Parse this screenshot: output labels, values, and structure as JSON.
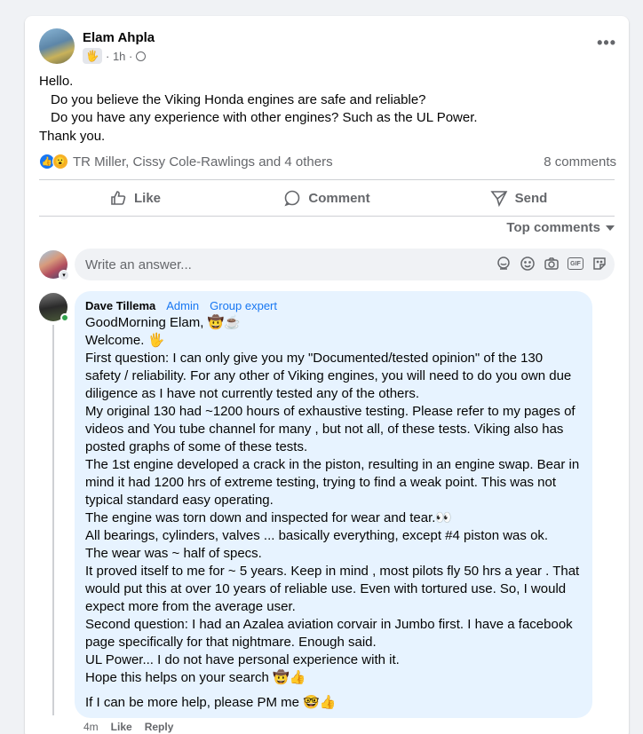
{
  "post": {
    "author": "Elam Ahpla",
    "badge_icon": "wave-hand-icon",
    "time": "· 1h ·",
    "privacy_icon": "globe-icon",
    "more_label": "•••",
    "lines": [
      "Hello.",
      "Do you believe the Viking Honda engines are safe and reliable?",
      "Do you have any experience with other engines? Such as the UL Power.",
      "Thank you."
    ],
    "reactions_text": "TR Miller, Cissy Cole-Rawlings and 4 others",
    "comments_count": "8 comments"
  },
  "actions": {
    "like": "Like",
    "comment": "Comment",
    "send": "Send"
  },
  "sort": {
    "label": "Top comments"
  },
  "composer": {
    "placeholder": "Write an answer..."
  },
  "comment": {
    "author": "Dave Tillema",
    "role1": "Admin",
    "role2": "Group expert",
    "lines": [
      "GoodMorning Elam, 🤠☕",
      "Welcome. 🖐",
      "First question: I can only give you my \"Documented/tested opinion\" of the 130",
      "safety / reliability. For any other of Viking engines, you will need to do you own due",
      "diligence as I have not currently tested any of the others.",
      "My original 130 had ~1200 hours of exhaustive testing. Please refer to my pages of",
      "videos and You tube channel for many , but not all, of these tests. Viking also has",
      "posted graphs of some of these tests.",
      "The 1st engine developed a crack in the piston, resulting in an engine swap. Bear in",
      "mind it had 1200 hrs of extreme testing, trying to find a weak point. This was not",
      "typical standard easy operating.",
      "The engine was torn down and inspected for wear and tear.👀",
      "All bearings, cylinders, valves ... basically everything, except #4 piston was ok.",
      "The wear was ~ half of specs.",
      "It proved itself to me for ~ 5 years. Keep in mind , most pilots fly 50 hrs a year . That",
      "would put this at over 10 years of reliable use. Even with tortured use. So, I would",
      "expect more from the average user.",
      "Second question: I had an Azalea aviation corvair in Jumbo first. I have a facebook",
      "page specifically for that nightmare. Enough said.",
      "UL Power... I do not have personal experience with it.",
      "Hope this helps on your search 🤠👍"
    ],
    "last_line": "If I can be more help, please PM me 🤓👍",
    "time": "4m",
    "like": "Like",
    "reply": "Reply"
  }
}
